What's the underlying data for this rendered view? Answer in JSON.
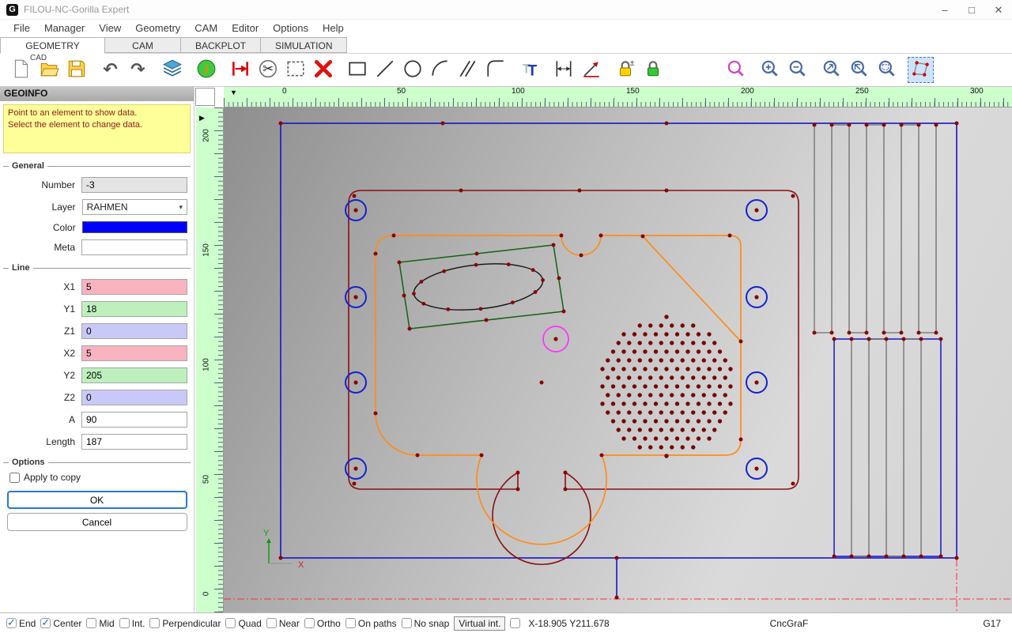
{
  "window": {
    "title": "FILOU-NC-Gorilla Expert",
    "logo_letter": "G",
    "minimize": "–",
    "maximize": "□",
    "close": "✕"
  },
  "menu": {
    "items": [
      "File",
      "Manager",
      "View",
      "Geometry",
      "CAM",
      "Editor",
      "Options",
      "Help"
    ]
  },
  "tabs": {
    "items": [
      "GEOMETRY",
      "CAM",
      "BACKPLOT",
      "SIMULATION"
    ],
    "active": "GEOMETRY",
    "cad_label": "CAD"
  },
  "toolbar": {
    "groups": [
      [
        "new-file",
        "open-folder",
        "save"
      ],
      [
        "undo",
        "redo"
      ],
      [
        "layers"
      ],
      [
        "info"
      ],
      [
        "point-move",
        "trim",
        "select-rect",
        "delete"
      ],
      [
        "rectangle",
        "line",
        "circle",
        "arc",
        "parallel",
        "chamfer"
      ],
      [
        "text"
      ],
      [
        "dimension",
        "leader"
      ],
      [
        "lock-tolerance",
        "lock"
      ],
      [
        "zoom-previous"
      ],
      [
        "zoom-in",
        "zoom-out"
      ],
      [
        "zoom-extents",
        "zoom-selected",
        "zoom-window"
      ],
      [
        "edit-points"
      ]
    ],
    "selected_icon": "edit-points"
  },
  "sidebar": {
    "title": "GEOINFO",
    "info_line1": "Point to an element to show data.",
    "info_line2": "Select the element to change data.",
    "general_label": "General",
    "number_label": "Number",
    "number_value": "-3",
    "layer_label": "Layer",
    "layer_value": "RAHMEN",
    "color_label": "Color",
    "color_value": "#0000ff",
    "meta_label": "Meta",
    "meta_value": "",
    "line_label": "Line",
    "line_fields": [
      {
        "label": "X1",
        "value": "5",
        "bg": "#f7b3c0"
      },
      {
        "label": "Y1",
        "value": "18",
        "bg": "#bdf0bd"
      },
      {
        "label": "Z1",
        "value": "0",
        "bg": "#c9c9f7"
      },
      {
        "label": "X2",
        "value": "5",
        "bg": "#f7b3c0"
      },
      {
        "label": "Y2",
        "value": "205",
        "bg": "#bdf0bd"
      },
      {
        "label": "Z2",
        "value": "0",
        "bg": "#c9c9f7"
      },
      {
        "label": "A",
        "value": "90",
        "bg": "#ffffff"
      },
      {
        "label": "Length",
        "value": "187",
        "bg": "#ffffff"
      }
    ],
    "options_label": "Options",
    "apply_label": "Apply to copy",
    "ok_label": "OK",
    "cancel_label": "Cancel"
  },
  "rulers": {
    "top": [
      "0",
      "50",
      "100",
      "150",
      "200",
      "250",
      "300"
    ],
    "left": [
      "200",
      "150",
      "100",
      "50",
      "0"
    ]
  },
  "statusbar": {
    "snaps": [
      {
        "label": "End",
        "checked": true
      },
      {
        "label": "Center",
        "checked": true
      },
      {
        "label": "Mid",
        "checked": false
      },
      {
        "label": "Int.",
        "checked": false
      },
      {
        "label": "Perpendicular",
        "checked": false
      },
      {
        "label": "Quad",
        "checked": false
      },
      {
        "label": "Near",
        "checked": false
      },
      {
        "label": "Ortho",
        "checked": false
      },
      {
        "label": "On paths",
        "checked": false
      },
      {
        "label": "No snap",
        "checked": false
      }
    ],
    "virtual_label": "Virtual int.",
    "coords": "X-18.905 Y211.678",
    "post": "CncGraF",
    "plane": "G17"
  }
}
